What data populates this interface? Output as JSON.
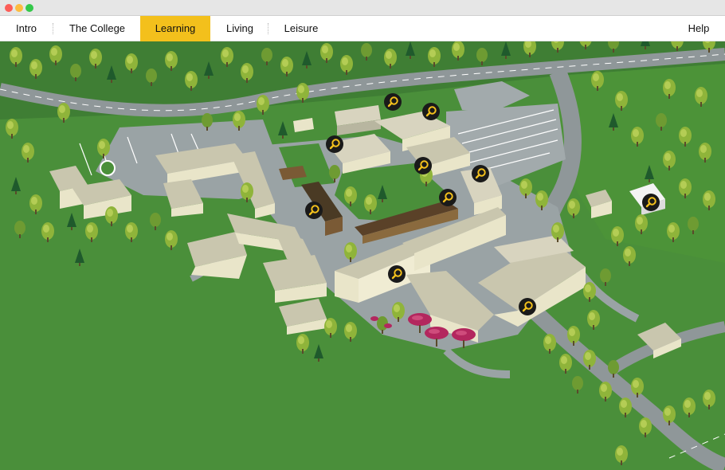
{
  "window": {
    "controls": [
      "close",
      "minimize",
      "zoom"
    ]
  },
  "nav": {
    "intro": "Intro",
    "college": "The College",
    "learning": "Learning",
    "living": "Living",
    "leisure": "Leisure",
    "help": "Help",
    "active": "Learning"
  },
  "map": {
    "hotspot_icon": "magnifier-icon",
    "hotspot_count": 11,
    "colors": {
      "grass": "#4a8f3a",
      "road": "#9aa3a5",
      "building_wall": "#e9e5c9",
      "building_roof": "#c9c6ae",
      "hotspot_ring": "#f3c01c",
      "hotspot_bg": "#1a1a1a",
      "accent_nav": "#f3c01c"
    }
  }
}
